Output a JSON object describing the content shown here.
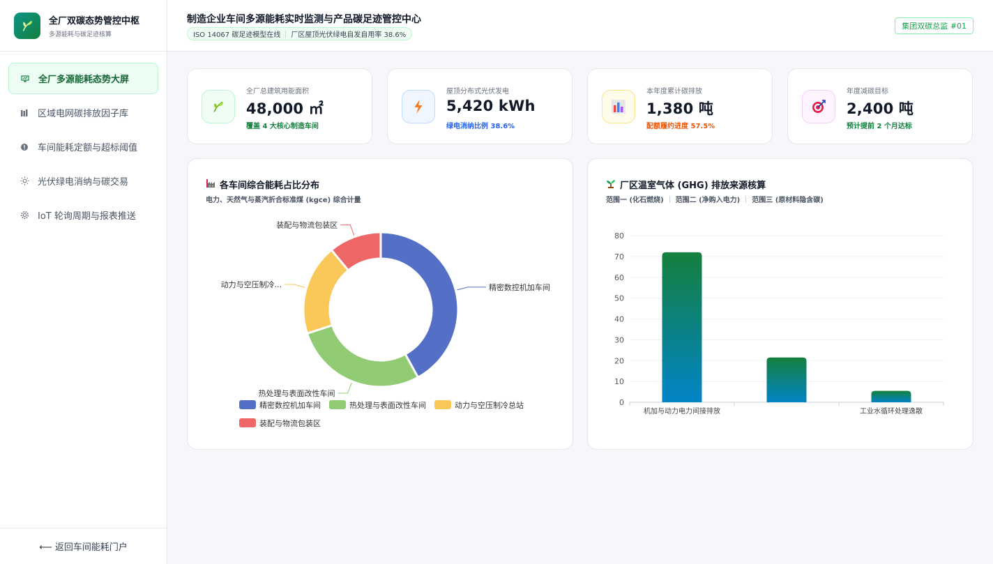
{
  "brand": {
    "title": "全厂双碳态势管控中枢",
    "subtitle": "多源能耗与碳足迹核算"
  },
  "sidebar": {
    "items": [
      {
        "label": "全厂多源能耗态势大屏",
        "icon": "dashboard-icon",
        "active": true
      },
      {
        "label": "区域电网碳排放因子库",
        "icon": "library-icon",
        "active": false
      },
      {
        "label": "车间能耗定额与超标阈值",
        "icon": "alert-icon",
        "active": false
      },
      {
        "label": "光伏绿电消纳与碳交易",
        "icon": "sun-icon",
        "active": false
      },
      {
        "label": "IoT 轮询周期与报表推送",
        "icon": "gear-icon",
        "active": false
      }
    ],
    "footer": "⟵ 返回车间能耗门户"
  },
  "header": {
    "title": "制造企业车间多源能耗实时监测与产品碳足迹管控中心",
    "badge_left": "ISO 14067 碳足迹模型在线",
    "badge_right": "厂区屋顶光伏绿电自发自用率 38.6%",
    "user": "集团双碳总监 #01"
  },
  "kpis": [
    {
      "label": "全厂总建筑用能面积",
      "value": "48,000 ㎡",
      "note": "覆盖 4 大核心制造车间",
      "icon": "leaf-icon",
      "note_color": "#15803d"
    },
    {
      "label": "屋顶分布式光伏发电",
      "value": "5,420 kWh",
      "note": "绿电消纳比例 38.6%",
      "icon": "lightning-icon",
      "note_color": "#2563eb"
    },
    {
      "label": "本年度累计碳排放",
      "value": "1,380 吨",
      "note": "配额履约进度 57.5%",
      "icon": "bar-chart-icon",
      "note_color": "#ea580c"
    },
    {
      "label": "年度减碳目标",
      "value": "2,400 吨",
      "note": "预计提前 2 个月达标",
      "icon": "target-icon",
      "note_color": "#15803d"
    }
  ],
  "donut_panel": {
    "title": "各车间综合能耗占比分布",
    "icon": "factory-icon",
    "subtitle": "电力、天然气与蒸汽折合标准煤 (kgce) 综合计量"
  },
  "bar_panel": {
    "title": "厂区温室气体 (GHG) 排放来源核算",
    "icon": "seedling-icon",
    "subtitle_parts": [
      "范围一 (化石燃烧)",
      "范围二 (净购入电力)",
      "范围三 (原材料隐含碳)"
    ]
  },
  "chart_data": [
    {
      "type": "pie",
      "categories": [
        "精密数控机加车间",
        "热处理与表面改性车间",
        "动力与空压制冷总站",
        "装配与物流包装区"
      ],
      "values": [
        42,
        28,
        19,
        11
      ],
      "callout_labels": [
        "精密数控机加车间",
        "热处理与表面改性车间",
        "动力与空压制冷...",
        "装配与物流包装区"
      ],
      "colors": [
        "#5470c6",
        "#91cc75",
        "#fac858",
        "#ee6666"
      ],
      "legend": "bottom"
    },
    {
      "type": "bar",
      "categories": [
        "范围一 (化石燃烧)",
        "范围二 (净购入电力)",
        "范围三 (原材料隐含碳)"
      ],
      "tick_labels": [
        "机加与动力电力间接排放",
        "",
        "工业水循环处理逸散"
      ],
      "values": [
        72,
        21.5,
        5.5
      ],
      "ylim": [
        0,
        80
      ],
      "yticks": [
        0,
        10,
        20,
        30,
        40,
        50,
        60,
        70,
        80
      ],
      "grid": true,
      "colors": {
        "top": "#15803d",
        "bottom": "#0284c7"
      }
    }
  ]
}
